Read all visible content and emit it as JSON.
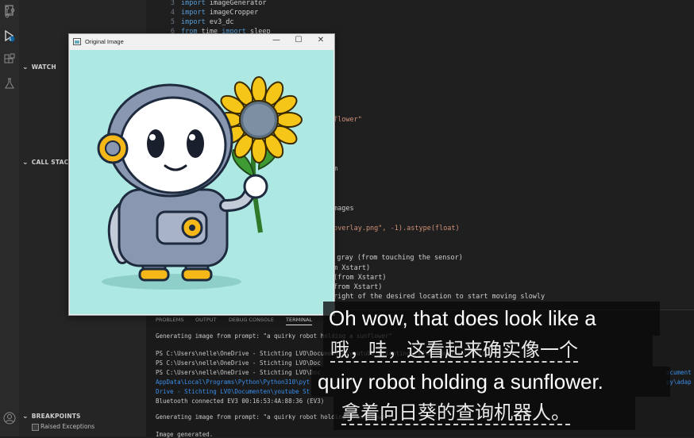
{
  "sidebar": {
    "watch_label": "WATCH",
    "callstack_label": "CALL STACK",
    "breakpoints_label": "BREAKPOINTS",
    "raised_exceptions_label": "Raised Exceptions",
    "debug_badge": "1"
  },
  "editor": {
    "lines": [
      {
        "num": "3",
        "kw": "import",
        "rest": " imageGenerator"
      },
      {
        "num": "4",
        "kw": "import",
        "rest": " imageCropper"
      },
      {
        "num": "5",
        "kw": "import",
        "rest": " ev3_dc"
      },
      {
        "num": "6",
        "kw": "from",
        "rest": " time ",
        "kw2": "import",
        "rest2": " sleep"
      }
    ],
    "fragments": {
      "flower": "flower\"",
      "m": "m",
      "images": "mages",
      "overlay": "overlay.png\", -1).astype(float)",
      "gray": "n gray (from touching the sensor)",
      "xstart1": "m Xstart)",
      "xstart2": "(from Xstart)",
      "xstart3": "from Xstart)",
      "right": "right of the desired location to start moving slowly"
    }
  },
  "panel": {
    "tabs": [
      "PROBLEMS",
      "OUTPUT",
      "DEBUG CONSOLE",
      "TERMINAL"
    ],
    "terminal_lines": [
      "Generating image from prompt: \"a quirky robot holding a sunflower\"",
      "PS C:\\Users\\nelle\\OneDrive - Stichting LVO\\Documenten\\youtube Stichting LVO\\Documenten\\youtube",
      "PS C:\\Users\\nelle\\OneDrive - Stichting LVO\\Doc",
      "PS C:\\Users\\nelle\\OneDrive - Stichting LVO\\Doc",
      "AppData\\Local\\Programs\\Python\\Python310\\pyt",
      "Drive - Stichting LVO\\Documenten\\youtube St",
      "Bluetooth connected EV3 00:16:53:4A:88:36 (EV3)",
      "Generating image from prompt: \"a quirky robot holding a sunflower\"",
      "Image generated."
    ],
    "right_fragments": [
      "ocument",
      "py\\adap"
    ]
  },
  "window": {
    "title": "Original Image",
    "minimize": "—",
    "maximize": "☐",
    "close": "✕"
  },
  "subtitles": {
    "en_line1": "Oh wow, that does look like a",
    "zh_line1": "哦，哇，这看起来确实像一个",
    "en_line2": "quiry robot holding a sunflower.",
    "zh_line2": "拿着向日葵的查询机器人。"
  },
  "colors": {
    "image_background": "#aee8e2",
    "petal": "#f5c518",
    "robot_body": "#8a97b0"
  }
}
